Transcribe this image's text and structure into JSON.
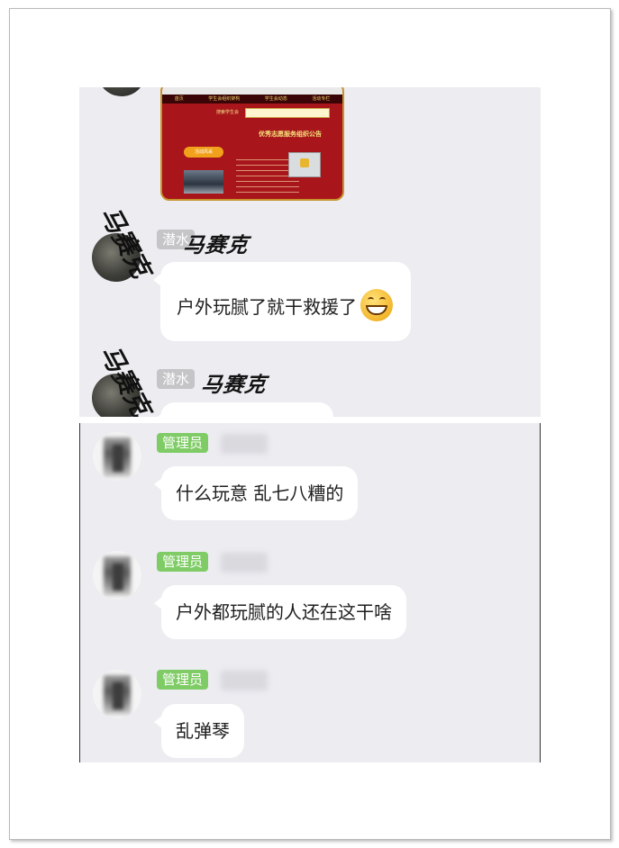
{
  "top_chat": {
    "embedded_screenshot": {
      "nav_items": [
        "首页",
        "学生会组织架构",
        "学生会动态",
        "活动专栏"
      ],
      "search_label": "搜索学生会",
      "heading": "优秀志愿服务组织公告",
      "pill_label": "活动风采"
    },
    "messages": [
      {
        "badge": "潜水",
        "nickname": "马赛克",
        "watermark": "马赛克",
        "text": "户外玩腻了就干救援了",
        "emoji": "grin-emoji"
      },
      {
        "badge": "潜水",
        "nickname": "马赛克",
        "watermark": "马赛克",
        "text": ""
      }
    ]
  },
  "bottom_chat": {
    "messages": [
      {
        "badge": "管理员",
        "text": "什么玩意  乱七八糟的"
      },
      {
        "badge": "管理员",
        "text": "户外都玩腻的人还在这干啥"
      },
      {
        "badge": "管理员",
        "text": "乱弹琴"
      }
    ]
  },
  "colors": {
    "chat_background": "#ececf1",
    "bubble": "#ffffff",
    "badge_member": "#c5c5c8",
    "badge_admin": "#7fcc66"
  }
}
